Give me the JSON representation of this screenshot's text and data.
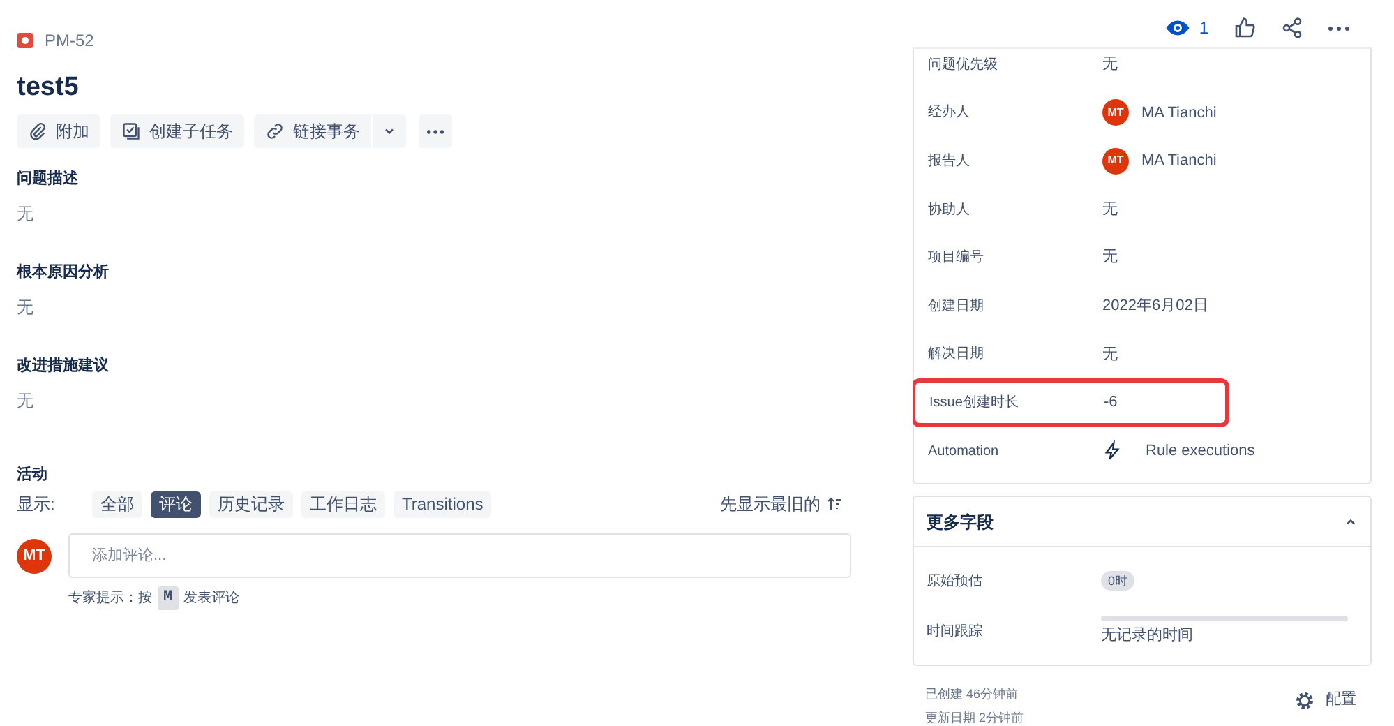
{
  "issue_key": "PM-52",
  "title": "test5",
  "actions": [
    {
      "kind": "attach",
      "label": "附加"
    },
    {
      "kind": "subtask",
      "label": "创建子任务"
    },
    {
      "kind": "link",
      "label": "链接事务"
    }
  ],
  "sections": [
    {
      "heading": "问题描述",
      "value": "无"
    },
    {
      "heading": "根本原因分析",
      "value": "无"
    },
    {
      "heading": "改进措施建议",
      "value": "无"
    }
  ],
  "activity": {
    "heading": "活动",
    "show_label": "显示:",
    "filters": [
      {
        "label": "全部",
        "selected": false
      },
      {
        "label": "评论",
        "selected": true
      },
      {
        "label": "历史记录",
        "selected": false
      },
      {
        "label": "工作日志",
        "selected": false
      },
      {
        "label": "Transitions",
        "selected": false
      }
    ],
    "sort": "先显示最旧的",
    "avatar": "MT",
    "comment_placeholder": "添加评论...",
    "tip_prefix": "专家提示：按",
    "tip_key": "M",
    "tip_suffix": "发表评论"
  },
  "header": {
    "watchers": "1"
  },
  "details": [
    {
      "label": "问题优先级",
      "kind": "text",
      "value": "无",
      "highlighted": false
    },
    {
      "label": "经办人",
      "kind": "user",
      "avatar": "MT",
      "value": "MA Tianchi",
      "highlighted": false
    },
    {
      "label": "报告人",
      "kind": "user",
      "avatar": "MT",
      "value": "MA Tianchi",
      "highlighted": false
    },
    {
      "label": "协助人",
      "kind": "text",
      "value": "无",
      "highlighted": false
    },
    {
      "label": "项目编号",
      "kind": "text",
      "value": "无",
      "highlighted": false
    },
    {
      "label": "创建日期",
      "kind": "text",
      "value": "2022年6月02日",
      "highlighted": false
    },
    {
      "label": "解决日期",
      "kind": "text",
      "value": "无",
      "highlighted": false
    },
    {
      "label": "Issue创建时长",
      "kind": "text",
      "value": "-6",
      "highlighted": true
    },
    {
      "label": "Automation",
      "kind": "automation",
      "value": "Rule executions",
      "highlighted": false
    }
  ],
  "more_fields": {
    "heading": "更多字段",
    "expanded": true,
    "rows": [
      {
        "label": "原始预估",
        "kind": "lozenge",
        "value": "0时"
      },
      {
        "label": "时间跟踪",
        "kind": "tracking",
        "value": "无记录的时间",
        "level": 0
      }
    ]
  },
  "footer": {
    "created": "已创建 46分钟前",
    "updated": "更新日期 2分钟前",
    "configure": "配置"
  }
}
